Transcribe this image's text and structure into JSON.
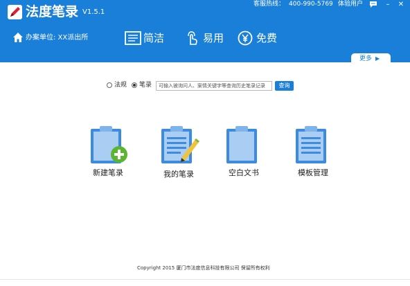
{
  "header": {
    "app_title": "法度笔录",
    "version": "V1.5.1",
    "hotline_label": "客服热线：",
    "hotline_number": "400-990-5769",
    "trial_user": "体验用户",
    "unit_label": "办案单位:  XX派出所",
    "features": [
      {
        "icon": "document-icon",
        "label": "简洁"
      },
      {
        "icon": "touch-icon",
        "label": "易用"
      },
      {
        "icon": "yen-icon",
        "label": "免费"
      }
    ],
    "more_label": "更多",
    "more_arrow": "▶",
    "window_controls": {
      "chat": "💬",
      "minimize": "–",
      "close": "✕"
    }
  },
  "search": {
    "options": [
      {
        "label": "法规",
        "selected": false
      },
      {
        "label": "笔录",
        "selected": true
      }
    ],
    "placeholder": "可输入被询问人、案情关键字等查询历史笔录记录",
    "button_label": "查询"
  },
  "tiles": [
    {
      "label": "新建笔录",
      "icon": "clipboard-add-icon"
    },
    {
      "label": "我的笔录",
      "icon": "clipboard-edit-icon"
    },
    {
      "label": "空白文书",
      "icon": "clipboard-blank-icon"
    },
    {
      "label": "模板管理",
      "icon": "clipboard-list-icon"
    }
  ],
  "footer": {
    "copyright": "Copyright  2015  厦门市法度信息科技有限公司  保留所有权利"
  },
  "colors": {
    "primary": "#1a7fd8",
    "tile_blue": "#3d8be0",
    "tile_paper": "#a9cdf3",
    "accent_green": "#5cb531"
  }
}
